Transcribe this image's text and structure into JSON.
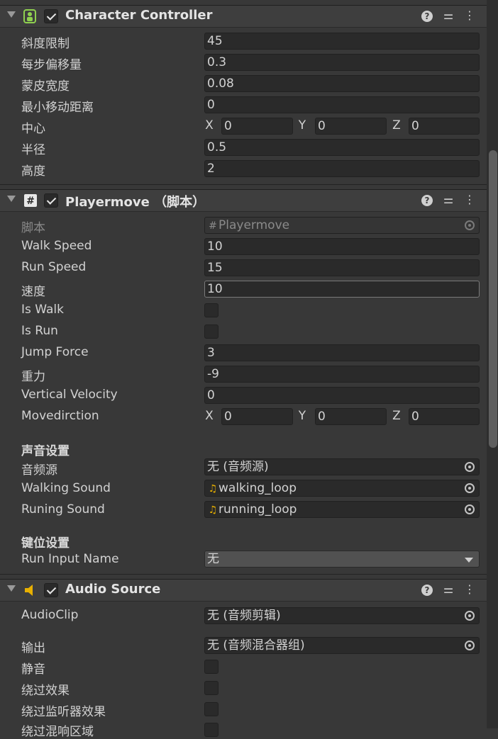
{
  "character_controller": {
    "title": "Character Controller",
    "fields": [
      {
        "label": "斜度限制",
        "value": "45"
      },
      {
        "label": "每步偏移量",
        "value": "0.3"
      },
      {
        "label": "蒙皮宽度",
        "value": "0.08"
      },
      {
        "label": "最小移动距离",
        "value": "0"
      }
    ],
    "center": {
      "label": "中心",
      "x": "0",
      "y": "0",
      "z": "0"
    },
    "radius": {
      "label": "半径",
      "value": "0.5"
    },
    "height": {
      "label": "高度",
      "value": "2"
    }
  },
  "playermove": {
    "title": "Playermove （脚本）",
    "script_label": "脚本",
    "script_value": "Playermove",
    "walk_speed": {
      "label": "Walk Speed",
      "value": "10"
    },
    "run_speed": {
      "label": "Run Speed",
      "value": "15"
    },
    "speed": {
      "label": "速度",
      "value": "10"
    },
    "is_walk": {
      "label": "Is Walk"
    },
    "is_run": {
      "label": "Is Run"
    },
    "jump_force": {
      "label": "Jump Force",
      "value": "3"
    },
    "gravity": {
      "label": "重力",
      "value": "-9"
    },
    "vertical_velocity": {
      "label": "Vertical Velocity",
      "value": "0"
    },
    "movedirction": {
      "label": "Movedirction",
      "x": "0",
      "y": "0",
      "z": "0"
    },
    "sound_header": "声音设置",
    "audio_source": {
      "label": "音频源",
      "value": "无 (音频源)"
    },
    "walking_sound": {
      "label": "Walking Sound",
      "value": "walking_loop"
    },
    "running_sound": {
      "label": "Runing Sound",
      "value": "running_loop"
    },
    "key_header": "键位设置",
    "run_input": {
      "label": "Run Input Name",
      "value": "无"
    }
  },
  "audio_source_comp": {
    "title": "Audio Source",
    "audio_clip": {
      "label": "AudioClip",
      "value": "无 (音频剪辑)"
    },
    "output": {
      "label": "输出",
      "value": "无 (音频混合器组)"
    },
    "mute": {
      "label": "静音"
    },
    "bypass_effects": {
      "label": "绕过效果"
    },
    "bypass_listener": {
      "label": "绕过监听器效果"
    },
    "bypass_reverb": {
      "label": "绕过混响区域"
    }
  },
  "axis": {
    "x": "X",
    "y": "Y",
    "z": "Z"
  },
  "icons": {
    "help": "?",
    "presets": "⚌",
    "more": "⋮",
    "script": "#",
    "music": "♫"
  },
  "colors": {
    "background": "#383838",
    "field": "#2a2a2a",
    "audio_icon": "#e8b000",
    "cc_icon": "#8fd14f"
  }
}
